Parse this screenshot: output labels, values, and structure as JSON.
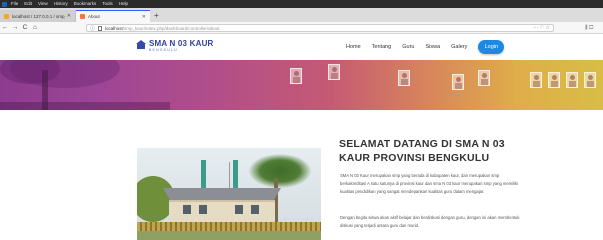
{
  "os": {
    "menu": [
      "File",
      "Edit",
      "View",
      "History",
      "Bookmarks",
      "Tools",
      "Help"
    ]
  },
  "browser": {
    "tabs": [
      {
        "title": "localhost / 127.0.0.1 / smp_ku...",
        "favicon_color": "#f5a623",
        "active": false
      },
      {
        "title": "About",
        "favicon_color": "#ff7043",
        "active": true
      }
    ],
    "new_tab": "+",
    "url_prefix": "localhost",
    "url_path": "/smp_kaur/index.php/dashboard/controller/about",
    "nav": {
      "back": "←",
      "forward": "→",
      "reload": "C",
      "home": "⌂"
    },
    "url_right": "··· ♡ ☆",
    "toolbar_right": "⫼ ▢"
  },
  "site": {
    "logo_name": "SMA N 03 KAUR",
    "logo_sub": "BENGKULU",
    "brand_color": "#303f9f",
    "nav": [
      "Home",
      "Tentang",
      "Guru",
      "Siswa",
      "Galery"
    ],
    "login": "Login",
    "login_color": "#1e88e5"
  },
  "content": {
    "title": "SELAMAT DATANG DI SMA N 03 KAUR PROVINSI BENGKULU",
    "paragraph1": "SMA N 03 Kaur merupakan smp yang berada di kabupaten kaur, dan merupakan smp berkakreditasi A satu satunya di provinsi kaur dan sma N 03 kaur merupakan smp yang memiliki kualitas pendidikan yang sangat mendepankan kualitas guru dalam mengajar.",
    "paragraph2": "Dengan begitu siswa akan aktif belajar dan berdiskusi dengan guru, dengan ini akan membentuk diskusi yang terjadi antara guru dan murid."
  }
}
